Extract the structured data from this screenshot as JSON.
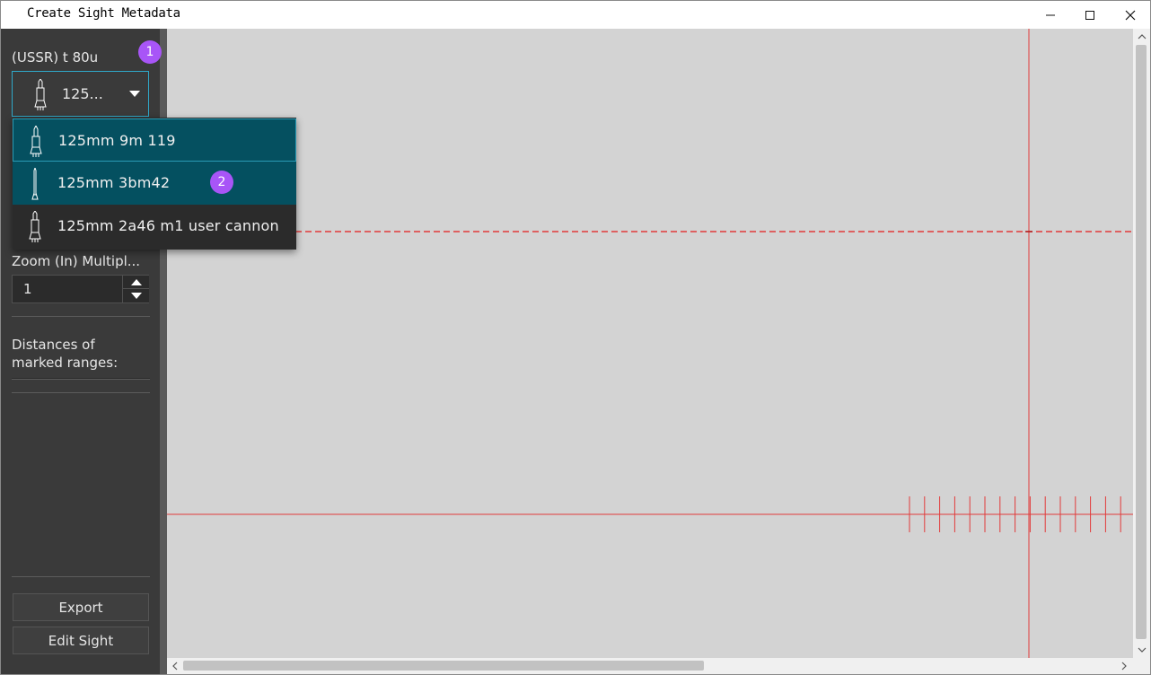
{
  "window": {
    "title": "Create Sight Metadata",
    "controls": {
      "minimize": "—",
      "maximize": "☐",
      "close": "✕"
    }
  },
  "sidebar": {
    "vehicle_label": "(USSR) t 80u",
    "ammo_combo": {
      "selected_text": "125...",
      "icon": "shell-icon"
    },
    "zoom_label": "Zoom (In) Multipl...",
    "zoom_value": "1",
    "distances_label": "Distances of marked ranges:",
    "export_button": "Export",
    "edit_sight_button": "Edit Sight"
  },
  "dropdown": {
    "items": [
      {
        "label": "125mm 9m 119",
        "icon": "missile-icon",
        "state": "hovered"
      },
      {
        "label": "125mm 3bm42",
        "icon": "apfsds-icon",
        "state": "selected"
      },
      {
        "label": "125mm 2a46 m1 user cannon",
        "icon": "shell-icon",
        "state": "normal"
      }
    ]
  },
  "badges": {
    "first": "1",
    "second": "2"
  },
  "colors": {
    "accent": "#2fa8c9",
    "selection": "#045060",
    "badge": "#a855f7",
    "reticle": "#e23b3b",
    "canvas": "#d3d3d3",
    "sidebar": "#3a3a3a"
  }
}
